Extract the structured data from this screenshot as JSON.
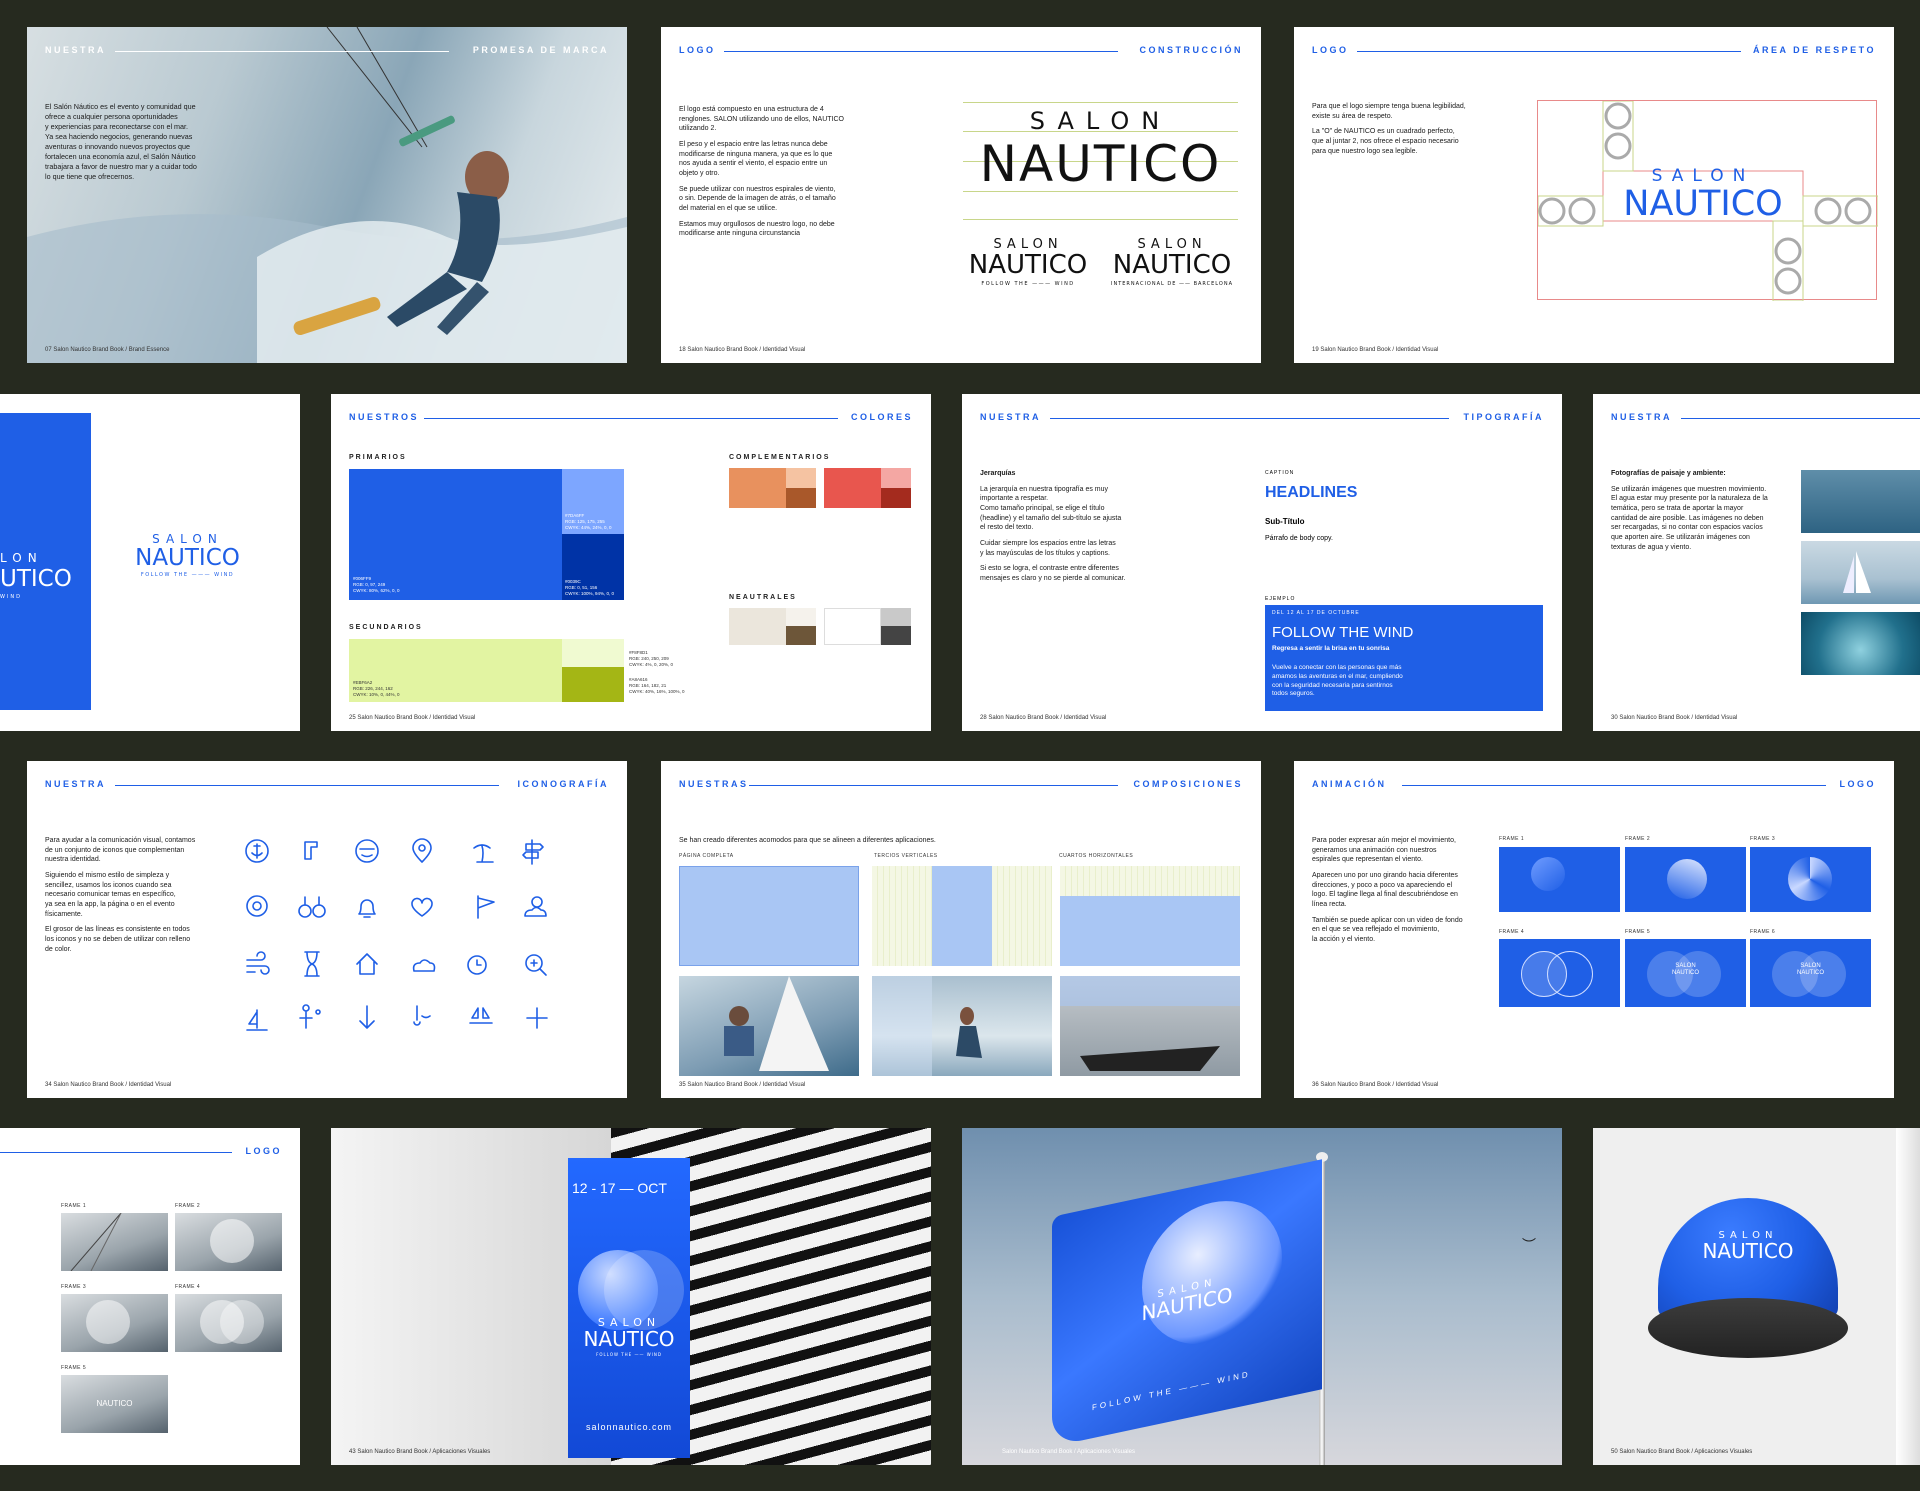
{
  "p1": {
    "hl": "NUESTRA",
    "hr": "PROMESA DE MARCA",
    "text": "El Salón Náutico es el evento y comunidad que\nofrece a cualquier persona oportunidades\ny experiencias para reconectarse con el mar.\nYa sea haciendo negocios, generando nuevas\naventuras o innovando nuevos proyectos que\nfortalecen una economía azul, el Salón Náutico\ntrabajara a favor de nuestro mar y a cuidar todo\nlo que tiene que ofrecernos.",
    "foot": "07    Salon Nautico Brand Book / Brand Essence"
  },
  "p2": {
    "hl": "LOGO",
    "hr": "CONSTRUCCIÓN",
    "paras": [
      "El logo está compuesto en una estructura de 4\nrenglones. SALON utilizando uno de ellos, NAUTICO\nutilizando 2.",
      "El peso y el espacio entre las letras nunca debe\nmodificarse de ninguna manera, ya que es lo que\nnos ayuda a sentir el viento, el espacio entre un\nobjeto y otro.",
      "Se puede utilizar con nuestros espirales de viento,\no sin. Depende de la imagen de atrás, o el tamaño\ndel material en el que se utilice.",
      "Estamos muy orgullosos de nuestro logo, no debe\nmodificarse ante ninguna circunstancia"
    ],
    "salon": "SALON",
    "nautico": "NAUTICO",
    "ftw": "FOLLOW THE ——— WIND",
    "int": "INTERNACIONAL DE —— BARCELONA",
    "foot": "18    Salon Nautico Brand Book / Identidad Visual"
  },
  "p3": {
    "hl": "LOGO",
    "hr": "ÁREA DE RESPETO",
    "paras": [
      "Para que el logo siempre tenga buena legibilidad,\nexiste su área de respeto.",
      "La \"O\" de NAUTICO es un cuadrado perfecto,\nque al juntar 2, nos ofrece el espacio necesario\npara que nuestro logo sea legible."
    ],
    "salon": "SALON",
    "nautico": "NAUTICO",
    "foot": "19    Salon Nautico Brand Book / Identidad Visual"
  },
  "p4": {
    "salon_c": "LON",
    "nautico_c": "UTICO",
    "wind_c": "WIND",
    "salon": "SALON",
    "nautico": "NAUTICO",
    "ftw": "FOLLOW THE ——— WIND"
  },
  "p5": {
    "hl": "NUESTROS",
    "hr": "COLORES",
    "prim": "PRIMARIOS",
    "sec": "SECUNDARIOS",
    "comp": "COMPLEMENTARIOS",
    "neu": "NEAUTRALES",
    "c1": "#006FF9\nRGB: 0, 97, 249\nCWYK: 80%, 62%, 0, 0",
    "c2": "#7DA6FF\nRGB: 125, 175, 255\nCWYK: 44%, 24%, 0, 0",
    "c3": "#0039C\nRGB: 0, 51, 156\nCWYK: 100%, 94%, 0, 0",
    "c4": "#EBF6A2\nRGB: 226, 244, 162\nCWYK: 10%, 0, 44%, 0",
    "c5": "#F8F8D1\nRGB: 240, 250, 209\nCWYK: 4%, 0, 20%, 0",
    "c6": "#A8A616\nRGB: 164, 182, 21\nCWYK: 40%, 16%, 100%, 0",
    "foot": "25    Salon Nautico Brand Book / Identidad Visual"
  },
  "p6": {
    "hl": "NUESTRA",
    "hr": "TIPOGRAFÍA",
    "h": "Jerarquías",
    "paras": [
      "La jerarquía en nuestra tipografía es muy\nimportante a respetar.\nComo tamaño principal, se elige el título\n(headline) y el tamaño del sub-título se ajusta\nel resto del texto.",
      "Cuidar siempre los espacios entre las letras\ny las mayúsculas de los títulos y captions.",
      "Si esto se logra, el contraste entre diferentes\nmensajes es claro y no se pierde al comunicar."
    ],
    "caption": "CAPTION",
    "headlines": "HEADLINES",
    "subt": "Sub-Título",
    "body": "Párrafo de body copy.",
    "ejemplo": "EJEMPLO",
    "date": "DEL 12 AL 17 DE OCTUBRE",
    "ftw": "FOLLOW THE WIND",
    "tag": "Regresa a sentir la brisa en tu sonrisa",
    "ex": "Vuelve a conectar con las personas que más\namamos las aventuras en el mar, cumpliendo\ncon la seguridad necesaria para sentirnos\ntodos seguros.",
    "foot": "28    Salon Nautico Brand Book / Identidad Visual"
  },
  "p7": {
    "hl": "NUESTRA",
    "h": "Fotografías de paisaje y ambiente:",
    "text": "Se utilizarán imágenes que muestren movimiento.\nEl agua estar muy presente por la naturaleza de la\ntemática, pero se trata de aportar la mayor\ncantidad de aire posible. Las imágenes no deben\nser recargadas, si no contar con espacios vacíos\nque aporten aire. Se utilizarán imágenes con\ntexturas de agua y viento.",
    "foot": "30    Salon Nautico Brand Book / Identidad Visual"
  },
  "p8": {
    "hl": "NUESTRA",
    "hr": "ICONOGRAFÍA",
    "paras": [
      "Para ayudar a la comunicación visual, contamos\nde un conjunto de iconos que complementan\nnuestra identidad.",
      "Siguiendo el mismo estilo de simpleza y\nsencillez, usamos los iconos cuando sea\nnecesario comunicar temas en específico,\nya sea en la app, la página o en el evento\nfísicamente.",
      "El grosor de las líneas es consistente en todos\nlos iconos y no se deben de utilizar con relleno\nde color."
    ],
    "foot": "34    Salon Nautico Brand Book / Identidad Visual"
  },
  "p9": {
    "hl": "NUESTRAS",
    "hr": "COMPOSICIONES",
    "intro": "Se han creado diferentes acomodos para que se alineen a diferentes aplicaciones.",
    "l1": "PÁGINA COMPLETA",
    "l2": "TERCIOS VERTICALES",
    "l3": "CUARTOS HORIZONTALES",
    "foot": "35    Salon Nautico Brand Book / Identidad Visual"
  },
  "p10": {
    "hl": "ANIMACIÓN",
    "hr": "LOGO",
    "paras": [
      "Para poder expresar aún mejor el movimiento,\ngeneramos una animación con nuestros\nespirales que representan el viento.",
      "Aparecen uno por uno girando hacia diferentes\ndirecciones, y poco a poco va apareciendo el\nlogo. El tagline llega al final descubriéndose en\nlínea recta.",
      "También se puede aplicar con un video de fondo\nen el que se vea reflejado el movimiento,\nla acción y el viento."
    ],
    "frames": [
      "FRAME 1",
      "FRAME 2",
      "FRAME 3",
      "FRAME 4",
      "FRAME 5",
      "FRAME 6"
    ],
    "mini": "SALON\nNAUTICO",
    "foot": "36    Salon Nautico Brand Book / Identidad Visual"
  },
  "p11": {
    "hr": "LOGO",
    "frames": [
      "FRAME 1",
      "FRAME 2",
      "FRAME 3",
      "FRAME 4",
      "FRAME 5"
    ],
    "mini": "NAUTICO"
  },
  "p12": {
    "dates": "12 - 17 — OCT",
    "salon": "SALON",
    "nautico": "NAUTICO",
    "ftw": "FOLLOW THE —— WIND",
    "url": "salonnautico.com",
    "foot": "43    Salon Nautico Brand Book / Aplicaciones Visuales"
  },
  "p13": {
    "salon": "SALON",
    "nautico": "NAUTICO",
    "ftw": "FOLLOW THE ——— WIND",
    "foot": "Salon Nautico Brand Book / Aplicaciones Visuales"
  },
  "p14": {
    "salon": "SALON",
    "nautico": "NAUTICO",
    "foot": "50    Salon Nautico Brand Book / Aplicaciones Visuales"
  },
  "colors": {
    "brand": "#1f5fe6",
    "light_blue": "#7da6ff",
    "dark_blue": "#0033a6",
    "lime": "#e2f4a2",
    "lime_dark": "#a4b615"
  }
}
